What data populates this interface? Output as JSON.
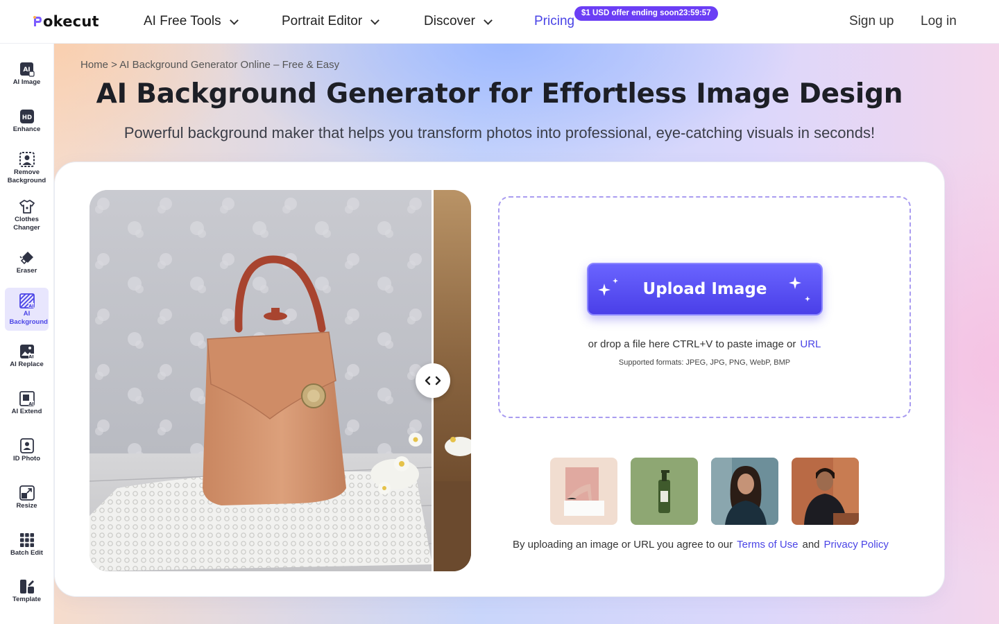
{
  "header": {
    "logo_text": "okecut",
    "nav": [
      {
        "label": "AI Free Tools"
      },
      {
        "label": "Portrait Editor"
      },
      {
        "label": "Discover"
      },
      {
        "label": "Pricing"
      }
    ],
    "offer_badge": "$1 USD offer ending soon23:59:57",
    "sign_up": "Sign up",
    "log_in": "Log in"
  },
  "sidebar": {
    "items": [
      {
        "label": "AI Image",
        "icon": "ai-image-icon"
      },
      {
        "label": "Enhance",
        "icon": "hd-enhance-icon"
      },
      {
        "label": "Remove Background",
        "icon": "remove-background-icon"
      },
      {
        "label": "Clothes Changer",
        "icon": "clothes-icon"
      },
      {
        "label": "Eraser",
        "icon": "eraser-icon"
      },
      {
        "label": "AI Background",
        "icon": "ai-background-icon",
        "active": true
      },
      {
        "label": "AI Replace",
        "icon": "ai-replace-icon"
      },
      {
        "label": "AI Extend",
        "icon": "ai-extend-icon"
      },
      {
        "label": "ID Photo",
        "icon": "id-photo-icon"
      },
      {
        "label": "Resize",
        "icon": "resize-icon"
      },
      {
        "label": "Batch Edit",
        "icon": "batch-edit-icon"
      },
      {
        "label": "Template",
        "icon": "template-icon"
      }
    ]
  },
  "hero": {
    "breadcrumb": "Home > AI Background Generator Online – Free & Easy",
    "title": "AI Background Generator for Effortless Image Design",
    "subtitle": "Powerful background maker that helps you transform photos into professional, eye-catching visuals in seconds!"
  },
  "upload": {
    "button_label": "Upload Image",
    "drop_text": "or drop a file here CTRL+V to paste image or",
    "url_link": "URL",
    "formats": "Supported formats: JPEG, JPG, PNG, WebP, BMP"
  },
  "terms": {
    "prefix": "By uploading an image or URL you agree to our",
    "terms_link": "Terms of Use",
    "and": "and",
    "privacy_link": "Privacy Policy"
  },
  "colors": {
    "accent": "#4a44e6",
    "badge": "#6b3ef5",
    "button": "#5a52f5"
  }
}
